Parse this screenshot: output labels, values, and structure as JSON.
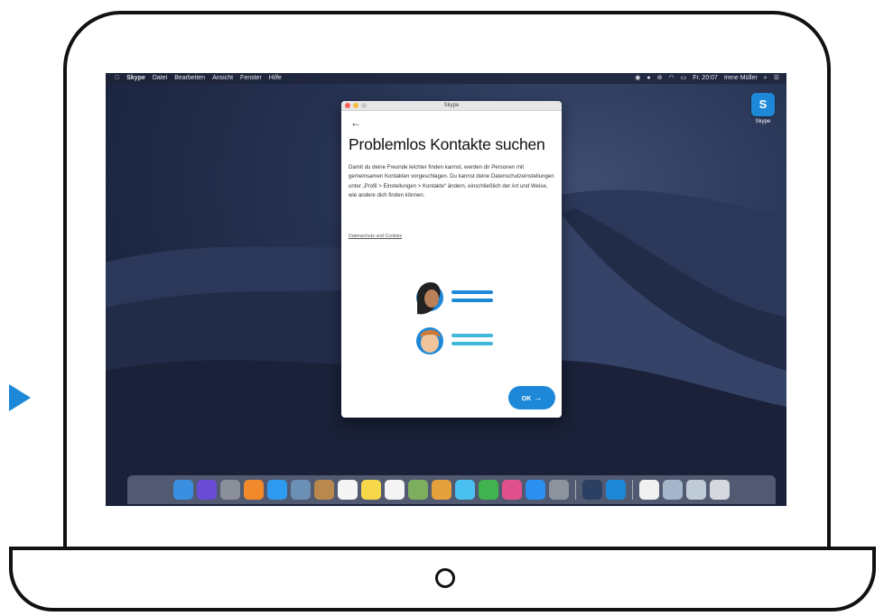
{
  "menubar": {
    "apple": "",
    "app": "Skype",
    "menus": [
      "Datei",
      "Bearbeiten",
      "Ansicht",
      "Fenster",
      "Hilfe"
    ],
    "clock": "Fr. 20:07",
    "user": "Irene Müller"
  },
  "desktop": {
    "skype_icon_label": "Skype",
    "skype_icon_glyph": "S"
  },
  "window": {
    "title": "Skype",
    "back_arrow": "←",
    "heading": "Problemlos Kontakte suchen",
    "body": "Damit du deine Freunde leichter finden kannst, werden dir Personen mit gemeinsamen Kontakten vorgeschlagen. Du kannst deine Datenschutzeinstellungen unter „Profil > Einstellungen > Kontakte“ ändern, einschließlich der Art und Weise, wie andere dich finden können.",
    "link": "Datenschutz und Cookies",
    "ok_label": "OK",
    "ok_arrow": "→"
  },
  "colors": {
    "accent": "#1e88d8",
    "traffic_red": "#fc605c",
    "traffic_yellow": "#fdbc40",
    "traffic_gray": "#c9c9c9",
    "line_blue": "#1e88d8"
  },
  "dock": {
    "icons": [
      {
        "name": "finder-icon",
        "color": "#3a8fe0"
      },
      {
        "name": "siri-icon",
        "color": "#6a4bd6"
      },
      {
        "name": "launchpad-icon",
        "color": "#8a8f99"
      },
      {
        "name": "firefox-icon",
        "color": "#f2892b"
      },
      {
        "name": "safari-icon",
        "color": "#2f9bf0"
      },
      {
        "name": "preview-icon",
        "color": "#6c8fb5"
      },
      {
        "name": "contacts-icon",
        "color": "#b8884d"
      },
      {
        "name": "calendar-icon",
        "color": "#f5f5f5"
      },
      {
        "name": "notes-icon",
        "color": "#f6d74a"
      },
      {
        "name": "reminders-icon",
        "color": "#f4f4f4"
      },
      {
        "name": "photo-booth-icon",
        "color": "#7cae5e"
      },
      {
        "name": "photos-icon",
        "color": "#e4a13c"
      },
      {
        "name": "messages-icon",
        "color": "#4ac0f0"
      },
      {
        "name": "facetime-icon",
        "color": "#40b24f"
      },
      {
        "name": "itunes-icon",
        "color": "#e0508a"
      },
      {
        "name": "app-store-icon",
        "color": "#2a8ff1"
      },
      {
        "name": "system-preferences-icon",
        "color": "#8d939c"
      },
      {
        "name": "quicktime-icon",
        "color": "#2b3f62"
      },
      {
        "name": "skype-icon",
        "color": "#1e88d8"
      },
      {
        "name": "document-icon",
        "color": "#f0f0f0"
      },
      {
        "name": "image-capture-icon",
        "color": "#a6b6ca"
      },
      {
        "name": "folder-icon",
        "color": "#c0cbd8"
      },
      {
        "name": "trash-icon",
        "color": "#d5d8de"
      }
    ]
  }
}
